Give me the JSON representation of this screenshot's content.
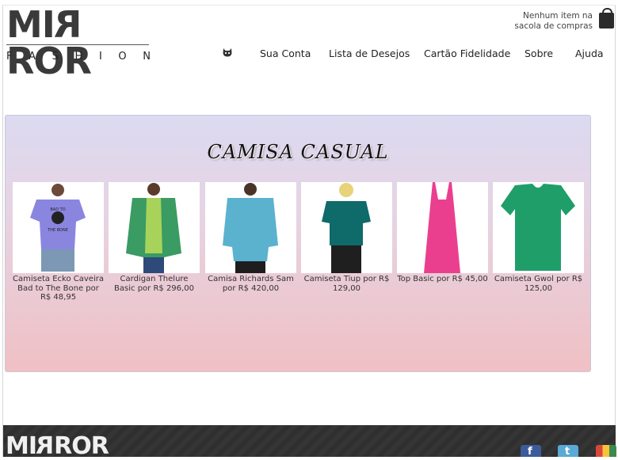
{
  "brand": {
    "logo_word": "MIRROR",
    "logo_sub_letters": [
      "F",
      "A",
      "S",
      "H",
      "I",
      "O",
      "N"
    ]
  },
  "bag": {
    "line1": "Nenhum item na",
    "line2": "sacola de compras",
    "icon": "shopping-bag-icon"
  },
  "nav": {
    "icon": "cat-icon",
    "items": [
      {
        "label": "Sua Conta"
      },
      {
        "label": "Lista de Desejos"
      },
      {
        "label": "Cartão Fidelidade"
      },
      {
        "label": "Sobre"
      },
      {
        "label": "Ajuda"
      }
    ]
  },
  "panel": {
    "title": "CAMISA CASUAL",
    "products": [
      {
        "caption": "Camiseta Ecko Caveira Bad to The Bone por R$ 48,95",
        "color": "#8a86e0",
        "image_text": "BAD TO THE BONE"
      },
      {
        "caption": "Cardigan Thelure Basic por R$ 296,00",
        "color": "#3a9b63"
      },
      {
        "caption": "Camisa Richards Sam por R$ 420,00",
        "color": "#5ab2cf"
      },
      {
        "caption": "Camiseta Tiup por R$ 129,00",
        "color": "#0f6a6a"
      },
      {
        "caption": "Top Basic por R$ 45,00",
        "color": "#ea3f8f"
      },
      {
        "caption": "Camiseta Gwol por R$ 125,00",
        "color": "#1f9e6a"
      }
    ]
  },
  "footer": {
    "logo_word": "MIRROR",
    "social": [
      {
        "name": "facebook",
        "glyph": "f"
      },
      {
        "name": "twitter",
        "glyph": "t"
      },
      {
        "name": "google-plus",
        "glyph": ""
      }
    ]
  }
}
